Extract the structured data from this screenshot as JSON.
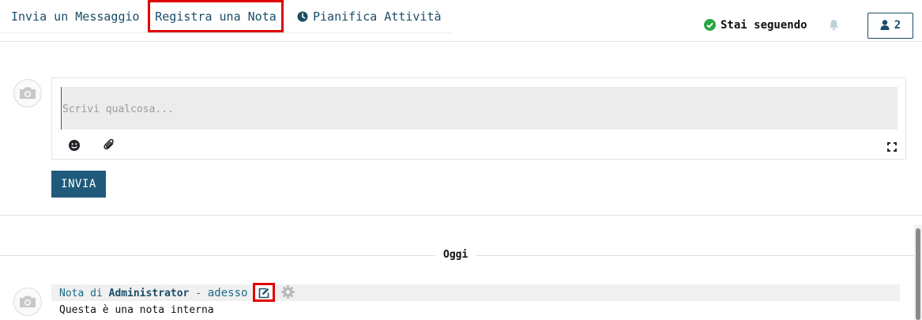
{
  "tabs": {
    "send_message": "Invia un Messaggio",
    "log_note": "Registra una Nota",
    "schedule_activity": "Pianifica Attività"
  },
  "follow": {
    "label": "Stai seguendo",
    "followers_count": "2"
  },
  "composer": {
    "placeholder": "Scrivi qualcosa...",
    "send_label": "INVIA"
  },
  "thread": {
    "date_separator": "Oggi",
    "messages": [
      {
        "prefix": "Nota di",
        "author": "Administrator",
        "separator": " - ",
        "time": "adesso",
        "body": "Questa è una nota interna"
      }
    ]
  },
  "colors": {
    "primary": "#1f5a7a",
    "link": "#1a4d66",
    "highlight_border": "#e00000",
    "following_check": "#28a745"
  },
  "icons": [
    "clock-icon",
    "check-circle-icon",
    "bell-icon",
    "user-icon",
    "camera-icon",
    "smile-icon",
    "paperclip-icon",
    "expand-icon",
    "edit-icon",
    "gear-icon"
  ]
}
